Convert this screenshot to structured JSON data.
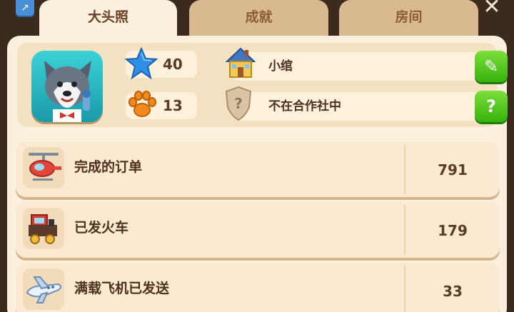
{
  "tabs": [
    {
      "label": "大头照",
      "active": true
    },
    {
      "label": "成就",
      "active": false
    },
    {
      "label": "房间",
      "active": false
    }
  ],
  "profile": {
    "stars": "40",
    "paws": "13",
    "name": "小绾",
    "coop_status": "不在合作社中"
  },
  "stats": [
    {
      "label": "完成的订单",
      "value": "791",
      "icon": "helicopter-icon"
    },
    {
      "label": "已发火车",
      "value": "179",
      "icon": "train-icon"
    },
    {
      "label": "满载飞机已发送",
      "value": "33",
      "icon": "airplane-icon"
    }
  ],
  "colors": {
    "accent_green": "#37b20c",
    "star_blue": "#2f8fe8",
    "paw_orange": "#f08a1c"
  }
}
